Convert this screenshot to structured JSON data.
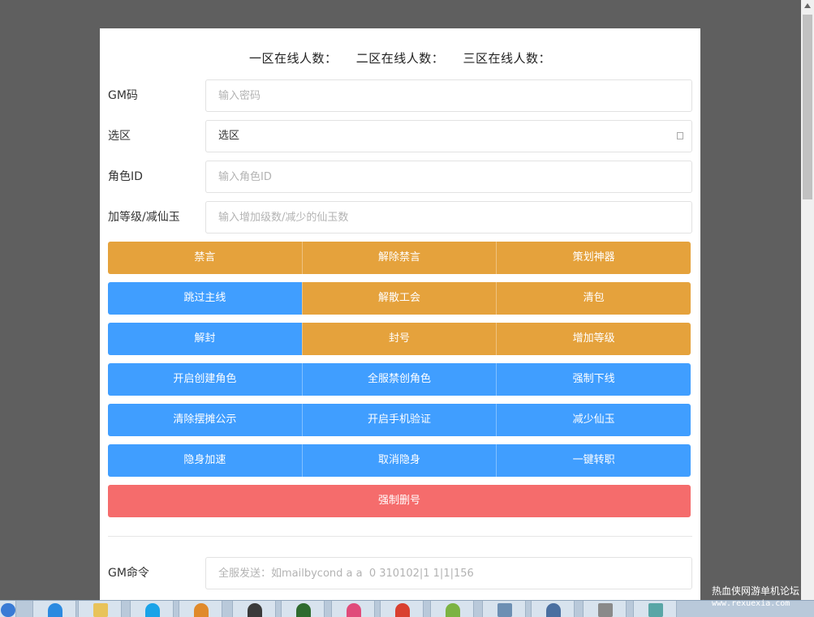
{
  "header": {
    "zone1": "一区在线人数：",
    "zone2": "二区在线人数：",
    "zone3": "三区在线人数："
  },
  "form": {
    "gm_code": {
      "label": "GM码",
      "placeholder": "输入密码"
    },
    "zone_select": {
      "label": "选区",
      "value": "选区"
    },
    "role_id": {
      "label": "角色ID",
      "placeholder": "输入角色ID"
    },
    "level_jade": {
      "label": "加等级/减仙玉",
      "placeholder": "输入增加级数/减少的仙玉数"
    },
    "gm_command": {
      "label": "GM命令",
      "placeholder": "全服发送：如mailbycond a a  0 310102|1 1|1|156"
    }
  },
  "buttons": {
    "row1": [
      "禁言",
      "解除禁言",
      "策划神器"
    ],
    "row2": [
      "跳过主线",
      "解散工会",
      "清包"
    ],
    "row3": [
      "解封",
      "封号",
      "增加等级"
    ],
    "row4": [
      "开启创建角色",
      "全服禁创角色",
      "强制下线"
    ],
    "row5": [
      "清除摆摊公示",
      "开启手机验证",
      "减少仙玉"
    ],
    "row6": [
      "隐身加速",
      "取消隐身",
      "一键转职"
    ],
    "row7": [
      "强制删号"
    ]
  },
  "colors": {
    "warning": "#e5a23c",
    "primary": "#409eff",
    "danger": "#f56c6c"
  },
  "watermark": {
    "title": "热血侠网游单机论坛",
    "url": "www.rexuexia.com"
  }
}
